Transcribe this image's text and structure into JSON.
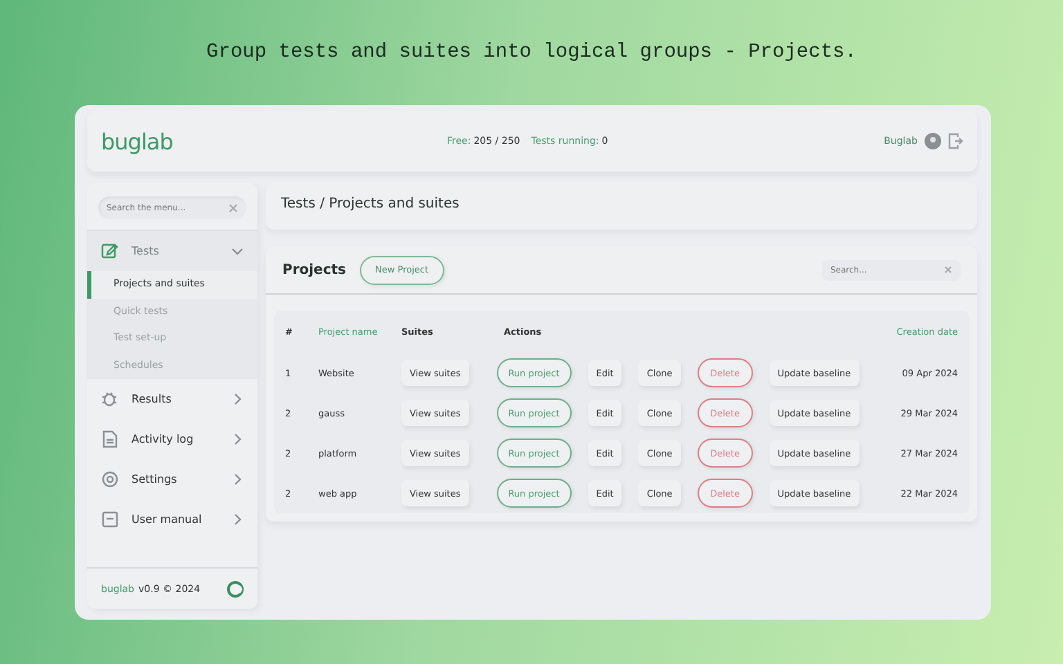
{
  "caption": "Group tests and suites into logical groups - Projects.",
  "header": {
    "logo": "buglab",
    "free_label": "Free:",
    "free_value": "205 / 250",
    "running_label": "Tests running:",
    "running_value": "0",
    "user": "Buglab"
  },
  "sidebar": {
    "search_placeholder": "Search the menu...",
    "items": [
      {
        "label": "Tests",
        "expanded": true,
        "children": [
          {
            "label": "Projects and suites",
            "selected": true
          },
          {
            "label": "Quick tests",
            "selected": false
          },
          {
            "label": "Test set-up",
            "selected": false
          },
          {
            "label": "Schedules",
            "selected": false
          }
        ]
      },
      {
        "label": "Results",
        "expanded": false
      },
      {
        "label": "Activity log",
        "expanded": false
      },
      {
        "label": "Settings",
        "expanded": false
      },
      {
        "label": "User manual",
        "expanded": false
      }
    ],
    "footer": {
      "brand": "buglab",
      "version": "v0.9 © 2024"
    }
  },
  "breadcrumb": "Tests / Projects and suites",
  "projects": {
    "title": "Projects",
    "new_button": "New Project",
    "search_placeholder": "Search...",
    "columns": [
      "#",
      "Project name",
      "Suites",
      "Actions",
      "Creation date"
    ],
    "rows": [
      {
        "num": "1",
        "name": "Website",
        "view": "View suites",
        "run": "Run project",
        "edit": "Edit",
        "clone": "Clone",
        "delete": "Delete",
        "update": "Update baseline",
        "date": "09 Apr 2024"
      },
      {
        "num": "2",
        "name": "gauss",
        "view": "View suites",
        "run": "Run project",
        "edit": "Edit",
        "clone": "Clone",
        "delete": "Delete",
        "update": "Update baseline",
        "date": "29 Mar 2024"
      },
      {
        "num": "2",
        "name": "platform",
        "view": "View suites",
        "run": "Run project",
        "edit": "Edit",
        "clone": "Clone",
        "delete": "Delete",
        "update": "Update baseline",
        "date": "27 Mar 2024"
      },
      {
        "num": "2",
        "name": "web app",
        "view": "View suites",
        "run": "Run project",
        "edit": "Edit",
        "clone": "Clone",
        "delete": "Delete",
        "update": "Update baseline",
        "date": "22 Mar 2024"
      }
    ]
  }
}
